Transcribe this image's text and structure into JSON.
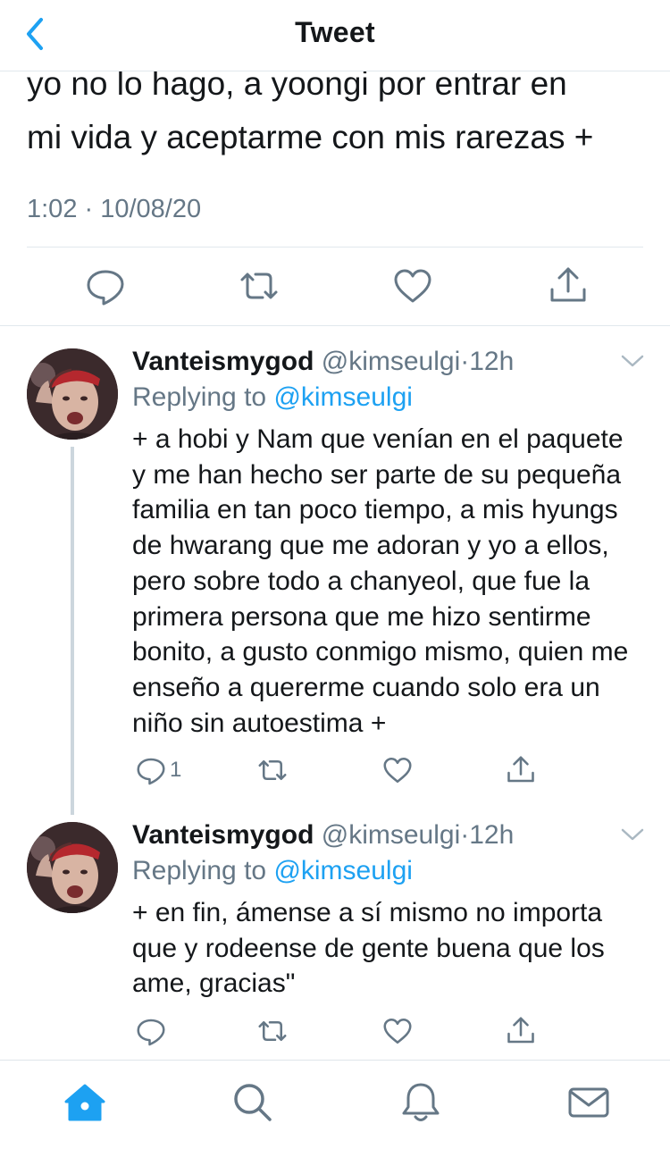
{
  "header": {
    "title": "Tweet",
    "back_icon": "chevron-left-icon"
  },
  "main_tweet": {
    "text_lines": [
      "yo no lo hago, a yoongi por entrar en",
      "mi vida y aceptarme con mis rarezas +"
    ],
    "timestamp": "1:02 · 10/08/20"
  },
  "replies": [
    {
      "display_name": "Vanteismygod",
      "handle": "@kimseulgi",
      "dot": "·",
      "time": "12h",
      "replying_prefix": "Replying to ",
      "replying_to": "@kimseulgi",
      "text_lines": [
        "+ a hobi y Nam que venían en el paquete",
        "y me han hecho ser parte de su pequeña",
        "familia en tan poco tiempo, a mis hyungs",
        "de hwarang que me adoran y yo a ellos,",
        "pero sobre todo a chanyeol, que fue la",
        "primera persona que me hizo sentirme",
        "bonito, a gusto conmigo mismo, quien me",
        "enseño a quererme cuando solo era un",
        "niño sin autoestima +"
      ],
      "reply_count": "1"
    },
    {
      "display_name": "Vanteismygod",
      "handle": "@kimseulgi",
      "dot": "·",
      "time": "12h",
      "replying_prefix": "Replying to ",
      "replying_to": "@kimseulgi",
      "text_lines": [
        "+ en fin, ámense a sí mismo no importa",
        "que y rodeense de gente buena que los",
        "ame, gracias\""
      ],
      "reply_count": ""
    }
  ],
  "tabbar": {
    "items": [
      "home-icon",
      "search-icon",
      "notifications-bell-icon",
      "messages-envelope-icon"
    ],
    "active": "home-icon"
  },
  "colors": {
    "accent": "#1da1f2",
    "text_primary": "#14171a",
    "text_secondary": "#657786",
    "divider": "#e1e8ed",
    "thread_line": "#ccd6dd"
  }
}
